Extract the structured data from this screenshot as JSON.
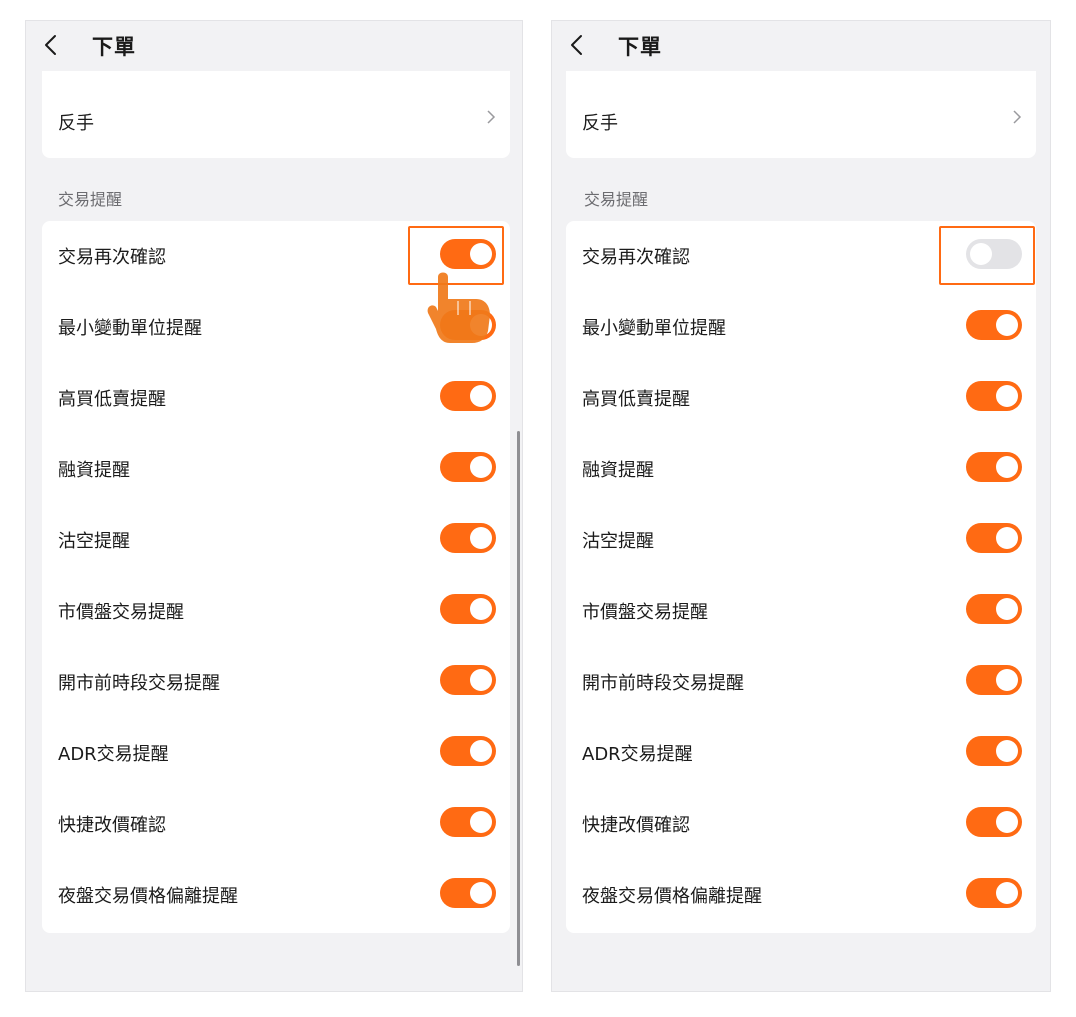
{
  "screens": [
    {
      "header": {
        "title": "下單"
      },
      "top_card": {
        "label": "反手"
      },
      "section": {
        "label": "交易提醒"
      },
      "items": [
        {
          "label": "交易再次確認",
          "on": true
        },
        {
          "label": "最小變動單位提醒",
          "on": true
        },
        {
          "label": "高買低賣提醒",
          "on": true
        },
        {
          "label": "融資提醒",
          "on": true
        },
        {
          "label": "沽空提醒",
          "on": true
        },
        {
          "label": "市價盤交易提醒",
          "on": true
        },
        {
          "label": "開市前時段交易提醒",
          "on": true
        },
        {
          "label": "ADR交易提醒",
          "on": true
        },
        {
          "label": "快捷改價確認",
          "on": true
        },
        {
          "label": "夜盤交易價格偏離提醒",
          "on": true
        }
      ]
    },
    {
      "header": {
        "title": "下單"
      },
      "top_card": {
        "label": "反手"
      },
      "section": {
        "label": "交易提醒"
      },
      "items": [
        {
          "label": "交易再次確認",
          "on": false
        },
        {
          "label": "最小變動單位提醒",
          "on": true
        },
        {
          "label": "高買低賣提醒",
          "on": true
        },
        {
          "label": "融資提醒",
          "on": true
        },
        {
          "label": "沽空提醒",
          "on": true
        },
        {
          "label": "市價盤交易提醒",
          "on": true
        },
        {
          "label": "開市前時段交易提醒",
          "on": true
        },
        {
          "label": "ADR交易提醒",
          "on": true
        },
        {
          "label": "快捷改價確認",
          "on": true
        },
        {
          "label": "夜盤交易價格偏離提醒",
          "on": true
        }
      ]
    }
  ],
  "colors": {
    "accent": "#ff6a13",
    "background": "#f2f2f4",
    "toggle_off": "#e3e3e6"
  },
  "icons": {
    "back": "chevron-left-icon",
    "more": "chevron-right-icon",
    "pointer": "tap-hand-icon"
  }
}
